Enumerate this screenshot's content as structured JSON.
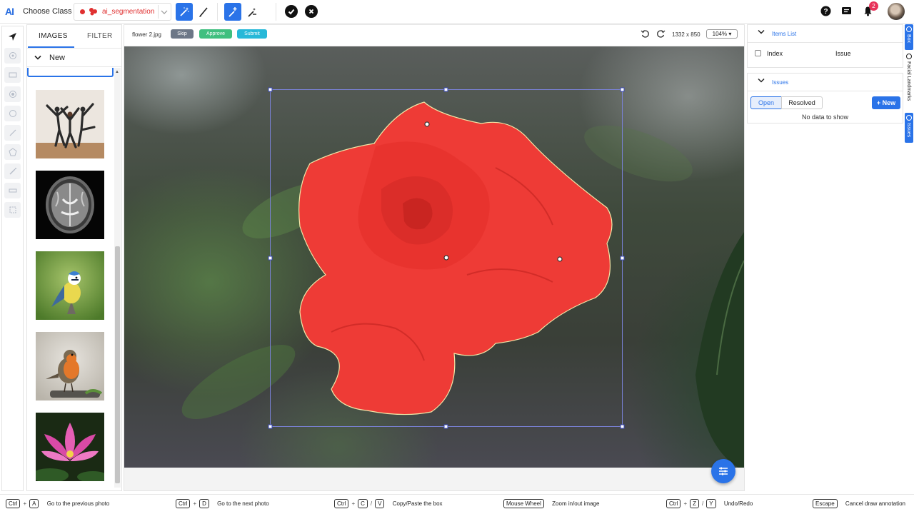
{
  "app": {
    "logo": "AI",
    "choose_class_label": "Choose Class"
  },
  "class_select": {
    "value": "ai_segmentation",
    "color": "#e03030"
  },
  "header": {
    "notification_count": "2"
  },
  "image_panel": {
    "tabs": [
      {
        "label": "IMAGES"
      },
      {
        "label": "FILTER"
      }
    ],
    "group": "New",
    "thumbnails": [
      "thumb-dancers",
      "thumb-brain-mri",
      "thumb-blue-tit",
      "thumb-robin",
      "thumb-lotus"
    ]
  },
  "canvas": {
    "filename": "flower 2.jpg",
    "skip_label": "Skip",
    "approve_label": "Approve",
    "submit_label": "Submit",
    "dimensions": "1332 x 850",
    "zoom": "104% ▾",
    "colors": {
      "skip": "#6c7787",
      "approve": "#3fbf7f",
      "submit": "#27b8d8",
      "mask": "#ee3b36",
      "bbox": "#7a82d8"
    }
  },
  "items_panel": {
    "title": "Items List",
    "col_index": "Index",
    "col_issue": "Issue"
  },
  "issues_panel": {
    "title": "Issues",
    "tab_open": "Open",
    "tab_resolved": "Resolved",
    "new_label": "+ New",
    "empty_text": "No data to show"
  },
  "side_tabs": [
    {
      "label": "Box"
    },
    {
      "label": "Facial Landmarks"
    },
    {
      "label": "Issues"
    }
  ],
  "shortcuts": [
    {
      "keys": [
        "Ctrl",
        "A"
      ],
      "sep": [
        "+"
      ],
      "desc": "Go to the previous photo"
    },
    {
      "keys": [
        "Ctrl",
        "D"
      ],
      "sep": [
        "+"
      ],
      "desc": "Go to the next photo"
    },
    {
      "keys": [
        "Ctrl",
        "C",
        "V"
      ],
      "sep": [
        "+",
        "/"
      ],
      "desc": "Copy/Paste the box"
    },
    {
      "keys": [
        "Mouse Wheel"
      ],
      "sep": [],
      "desc": "Zoom in/out image"
    },
    {
      "keys": [
        "Ctrl",
        "Z",
        "Y"
      ],
      "sep": [
        "+",
        "/"
      ],
      "desc": "Undo/Redo"
    },
    {
      "keys": [
        "Escape"
      ],
      "sep": [],
      "desc": "Cancel draw annotation"
    }
  ]
}
